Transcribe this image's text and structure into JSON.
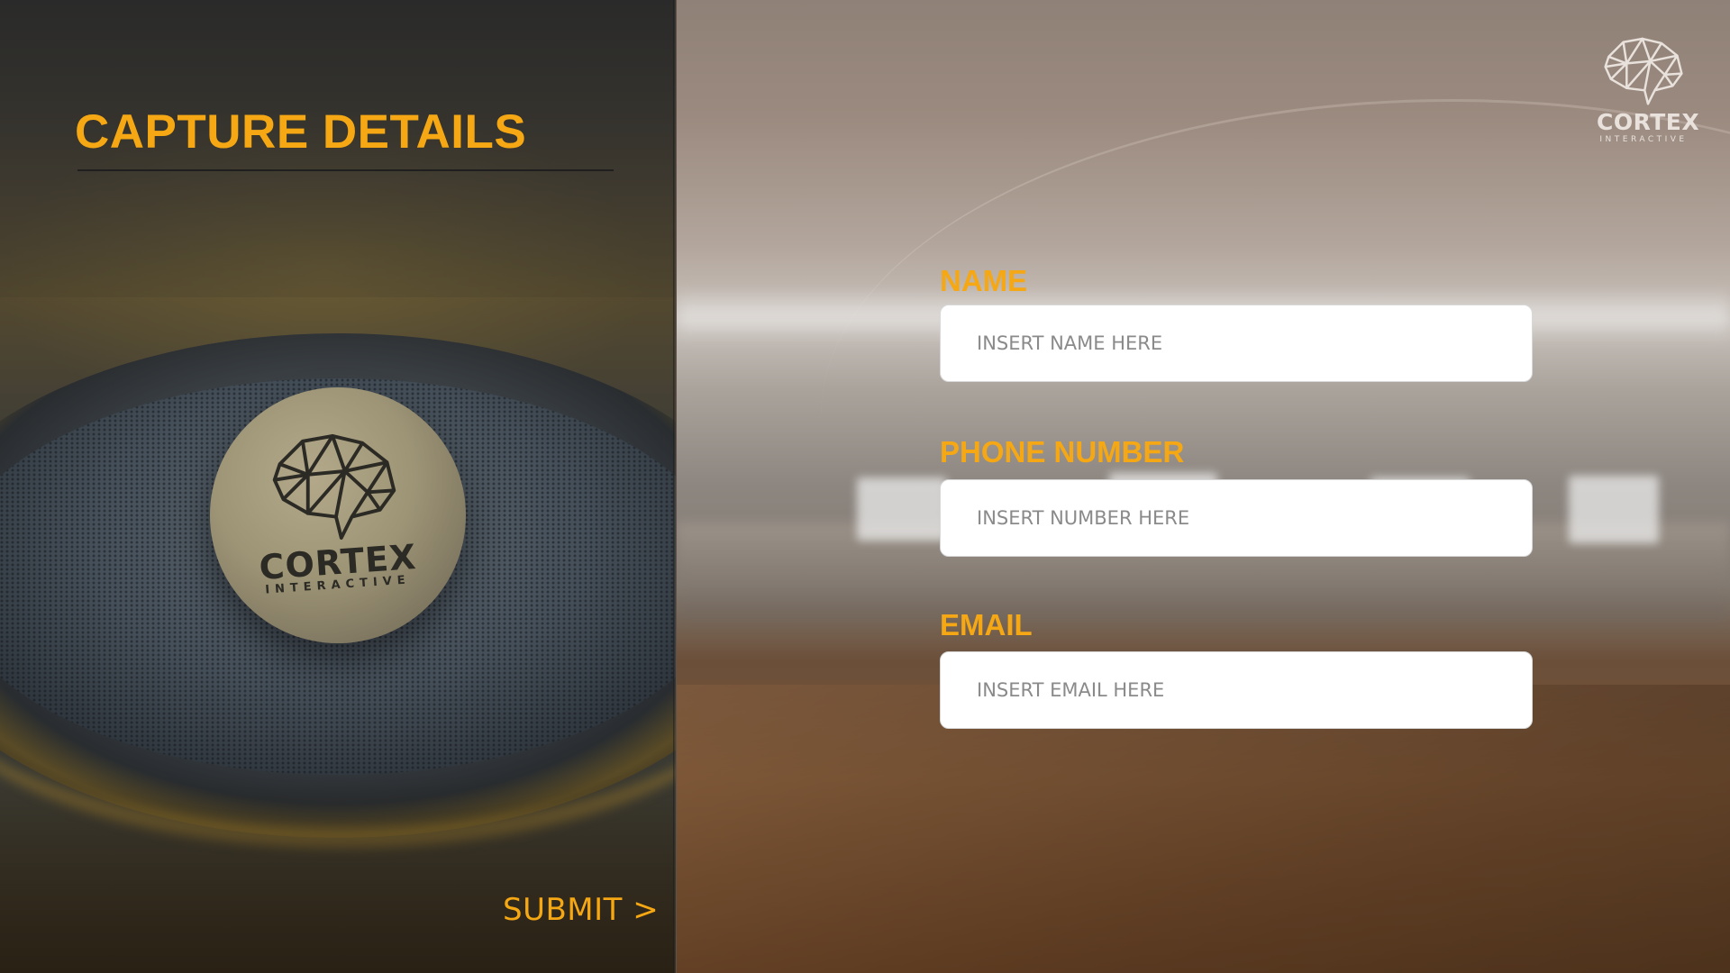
{
  "form": {
    "title": "CAPTURE DETAILS",
    "submit_label": "SUBMIT >",
    "fields": [
      {
        "label": "NAME",
        "placeholder": "INSERT NAME HERE",
        "value": ""
      },
      {
        "label": "PHONE NUMBER",
        "placeholder": "INSERT NUMBER HERE",
        "value": ""
      },
      {
        "label": "EMAIL",
        "placeholder": "INSERT EMAIL HERE",
        "value": ""
      }
    ]
  },
  "brand": {
    "name": "CORTEX",
    "tagline": "INTERACTIVE",
    "logo_icon": "brain-icon"
  },
  "colors": {
    "accent": "#f5a813",
    "input_bg": "#ffffff",
    "placeholder": "#8a8a8a"
  }
}
